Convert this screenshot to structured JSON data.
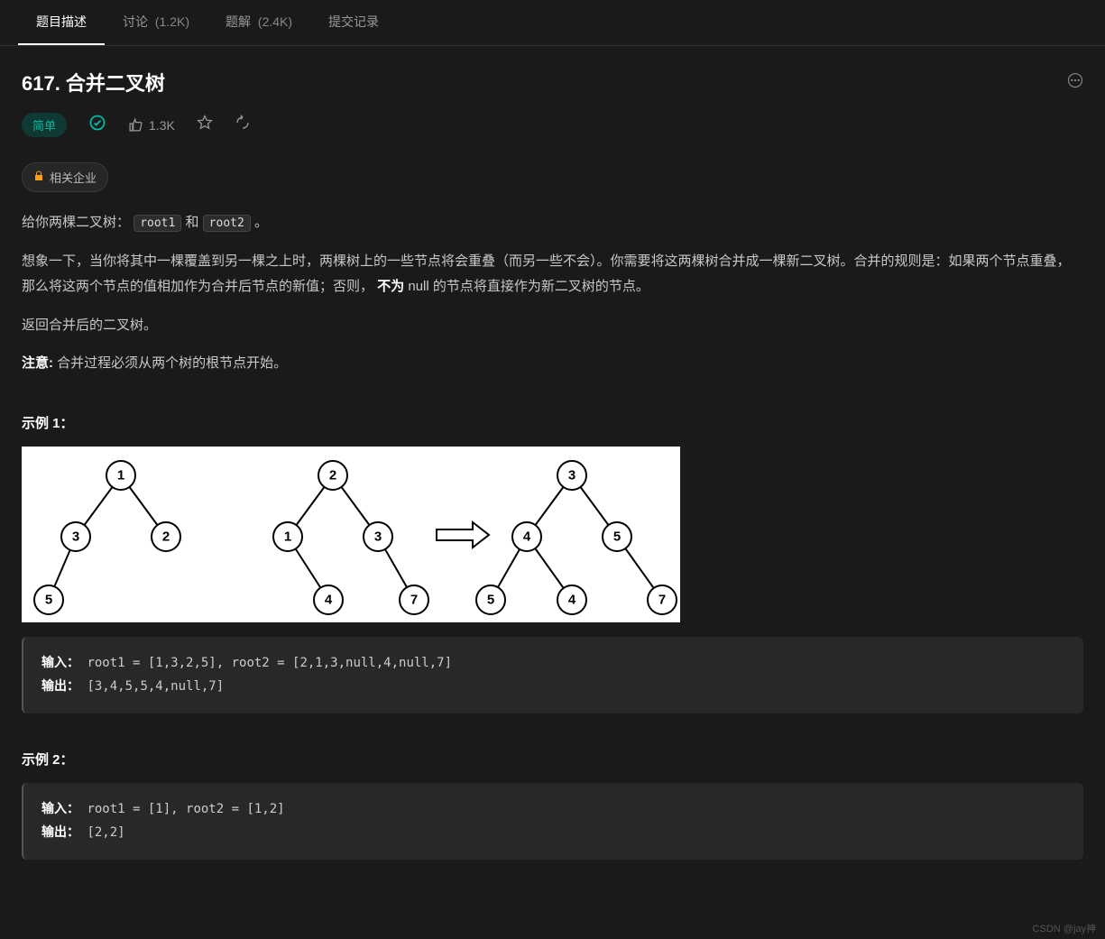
{
  "tabs": {
    "description": "题目描述",
    "discuss": "讨论",
    "discuss_count": "(1.2K)",
    "solutions": "题解",
    "solutions_count": "(2.4K)",
    "submissions": "提交记录"
  },
  "title": "617. 合并二叉树",
  "difficulty": "简单",
  "likes": "1.3K",
  "company_label": "相关企业",
  "desc": {
    "p1_a": "给你两棵二叉树：",
    "p1_code1": "root1",
    "p1_b": " 和 ",
    "p1_code2": "root2",
    "p1_c": " 。",
    "p2_a": "想象一下，当你将其中一棵覆盖到另一棵之上时，两棵树上的一些节点将会重叠（而另一些不会）。你需要将这两棵树合并成一棵新二叉树。合并的规则是：如果两个节点重叠，那么将这两个节点的值相加作为合并后节点的新值；否则，",
    "p2_bold": "不为",
    "p2_b": " null 的节点将直接作为新二叉树的节点。",
    "p3": "返回合并后的二叉树。",
    "p4_bold": "注意:",
    "p4_a": " 合并过程必须从两个树的根节点开始。"
  },
  "example1": {
    "label": "示例 1：",
    "input_label": "输入：",
    "input_value": "root1 = [1,3,2,5], root2 = [2,1,3,null,4,null,7]",
    "output_label": "输出：",
    "output_value": "[3,4,5,5,4,null,7]"
  },
  "example2": {
    "label": "示例 2：",
    "input_label": "输入：",
    "input_value": "root1 = [1], root2 = [1,2]",
    "output_label": "输出：",
    "output_value": "[2,2]"
  },
  "tree_data": {
    "tree1": {
      "root": "1",
      "l": "3",
      "r": "2",
      "ll": "5"
    },
    "tree2": {
      "root": "2",
      "l": "1",
      "r": "3",
      "lr": "4",
      "rr": "7"
    },
    "result": {
      "root": "3",
      "l": "4",
      "r": "5",
      "ll": "5",
      "lr": "4",
      "rr": "7"
    }
  },
  "watermark": "CSDN @jay神"
}
